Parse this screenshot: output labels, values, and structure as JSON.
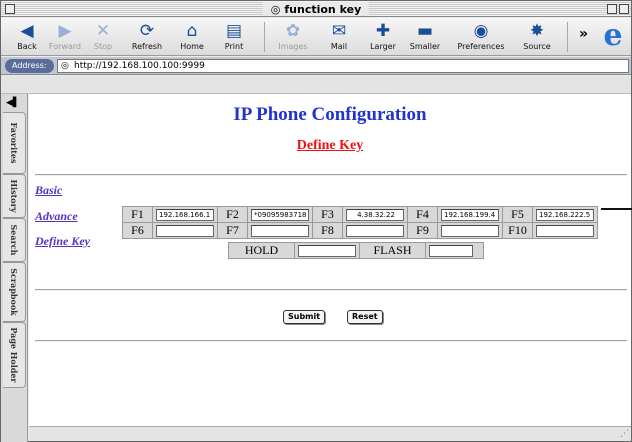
{
  "window": {
    "title": "function key"
  },
  "toolbar": {
    "buttons": [
      {
        "label": "Back",
        "icon": "back-arrow-icon",
        "glyph": "◀",
        "enabled": true
      },
      {
        "label": "Forward",
        "icon": "forward-arrow-icon",
        "glyph": "▶",
        "enabled": false
      },
      {
        "label": "Stop",
        "icon": "stop-icon",
        "glyph": "✕",
        "enabled": false
      },
      {
        "label": "Refresh",
        "icon": "refresh-icon",
        "glyph": "⟳",
        "enabled": true
      },
      {
        "label": "Home",
        "icon": "home-icon",
        "glyph": "⌂",
        "enabled": true
      },
      {
        "label": "Print",
        "icon": "print-icon",
        "glyph": "▤",
        "enabled": true
      },
      {
        "label": "Images",
        "icon": "images-icon",
        "glyph": "✿",
        "enabled": false
      },
      {
        "label": "Mail",
        "icon": "mail-icon",
        "glyph": "✉",
        "enabled": true
      },
      {
        "label": "Larger",
        "icon": "larger-icon",
        "glyph": "✚",
        "enabled": true
      },
      {
        "label": "Smaller",
        "icon": "smaller-icon",
        "glyph": "▬",
        "enabled": true
      },
      {
        "label": "Preferences",
        "icon": "preferences-icon",
        "glyph": "◉",
        "enabled": true
      },
      {
        "label": "Source",
        "icon": "source-icon",
        "glyph": "✸",
        "enabled": true
      }
    ],
    "overflow": "»",
    "browser_logo": "e"
  },
  "address": {
    "label": "Address:",
    "url": "http://192.168.100.100:9999"
  },
  "sidebar": {
    "tabs": [
      "Favorites",
      "History",
      "Search",
      "Scrapbook",
      "Page Holder"
    ]
  },
  "page": {
    "title": "IP Phone Configuration",
    "subtitle": "Define Key",
    "nav": [
      "Basic",
      "Advance",
      "Define Key"
    ],
    "function_keys": [
      {
        "key": "F1",
        "value": "192.168.166.1"
      },
      {
        "key": "F2",
        "value": "*09095983718"
      },
      {
        "key": "F3",
        "value": "4.38.32.22"
      },
      {
        "key": "F4",
        "value": "192.168.199.4"
      },
      {
        "key": "F5",
        "value": "192.168.222.5"
      },
      {
        "key": "F6",
        "value": ""
      },
      {
        "key": "F7",
        "value": ""
      },
      {
        "key": "F8",
        "value": ""
      },
      {
        "key": "F9",
        "value": ""
      },
      {
        "key": "F10",
        "value": ""
      }
    ],
    "hold": {
      "label": "HOLD",
      "value": ""
    },
    "flash": {
      "label": "FLASH",
      "value": ""
    },
    "submit_label": "Submit",
    "reset_label": "Reset"
  },
  "colors": {
    "title": "#2233cc",
    "subtitle": "#ee1111",
    "nav_link": "#5533bb"
  }
}
